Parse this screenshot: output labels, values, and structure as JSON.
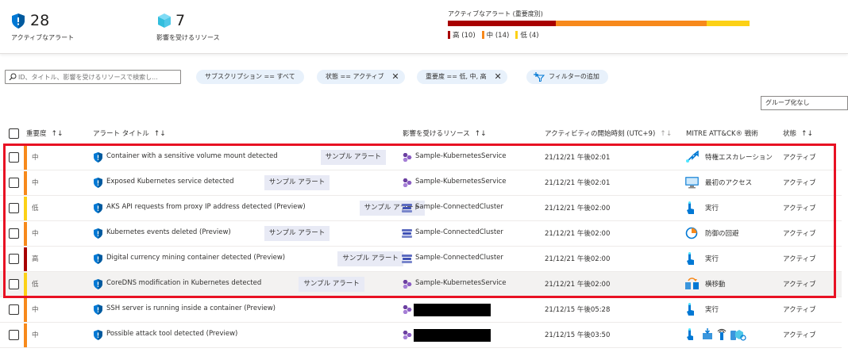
{
  "summary": {
    "active_alerts": {
      "count": "28",
      "label": "アクティブなアラート"
    },
    "affected_resources": {
      "count": "7",
      "label": "影響を受けるリソース"
    },
    "severity": {
      "title": "アクティブなアラート (重要度別)",
      "high": "高 (10)",
      "medium": "中 (14)",
      "low": "低 (4)",
      "colors": {
        "high": "#a80000",
        "medium": "#f7891b",
        "low": "#fcd116"
      },
      "shares": {
        "high": 0.357,
        "medium": 0.5,
        "low": 0.143
      }
    }
  },
  "filters": {
    "search_placeholder": "ID、タイトル、影響を受けるリソースで検索し...",
    "subscription": "サブスクリプション == すべて",
    "state": "状態 == アクティブ",
    "severity": "重要度 == 低, 中, 高",
    "add_filter": "フィルターの追加"
  },
  "group_by": "グループ化なし",
  "columns": {
    "severity": "重要度",
    "title": "アラート タイトル",
    "resource": "影響を受けるリソース",
    "start_time": "アクティビティの開始時刻 (UTC+9)",
    "tactics": "MITRE ATT&CK® 戦術",
    "status": "状態",
    "sort_glyph": "↑↓"
  },
  "sample_badge": "サンプル アラート",
  "rows": [
    {
      "severity": "中",
      "sev_color": "#f7891b",
      "title": "Container with a sensitive volume mount detected",
      "sample": true,
      "resource": "Sample-KubernetesService",
      "res_icon": "kubernetes-service-icon",
      "time": "21/12/21 午後02:01",
      "tactic": "特権エスカレーション",
      "tactic_icon": "privilege-escalation-icon",
      "status": "アクティブ"
    },
    {
      "severity": "中",
      "sev_color": "#f7891b",
      "title": "Exposed Kubernetes service detected",
      "sample": true,
      "resource": "Sample-KubernetesService",
      "res_icon": "kubernetes-service-icon",
      "time": "21/12/21 午後02:01",
      "tactic": "最初のアクセス",
      "tactic_icon": "initial-access-icon",
      "status": "アクティブ"
    },
    {
      "severity": "低",
      "sev_color": "#fcd116",
      "title": "AKS API requests from proxy IP address detected (Preview)",
      "sample": true,
      "resource": "Sample-ConnectedCluster",
      "res_icon": "connected-cluster-icon",
      "time": "21/12/21 午後02:00",
      "tactic": "実行",
      "tactic_icon": "execution-icon",
      "status": "アクティブ"
    },
    {
      "severity": "中",
      "sev_color": "#f7891b",
      "title": "Kubernetes events deleted (Preview)",
      "sample": true,
      "resource": "Sample-ConnectedCluster",
      "res_icon": "connected-cluster-icon",
      "time": "21/12/21 午後02:00",
      "tactic": "防御の回避",
      "tactic_icon": "defense-evasion-icon",
      "status": "アクティブ"
    },
    {
      "severity": "高",
      "sev_color": "#a80000",
      "title": "Digital currency mining container detected (Preview)",
      "sample": true,
      "resource": "Sample-ConnectedCluster",
      "res_icon": "connected-cluster-icon",
      "time": "21/12/21 午後02:00",
      "tactic": "実行",
      "tactic_icon": "execution-icon",
      "status": "アクティブ"
    },
    {
      "severity": "低",
      "sev_color": "#fcd116",
      "title": "CoreDNS modification in Kubernetes detected",
      "sample": true,
      "resource": "Sample-KubernetesService",
      "res_icon": "kubernetes-service-icon",
      "time": "21/12/21 午後02:00",
      "tactic": "横移動",
      "tactic_icon": "lateral-movement-icon",
      "status": "アクティブ"
    },
    {
      "severity": "中",
      "sev_color": "#f7891b",
      "title": "SSH server is running inside a container (Preview)",
      "sample": false,
      "resource": "",
      "res_icon": "kubernetes-service-icon",
      "time": "21/12/15 午後05:28",
      "tactic": "実行",
      "tactic_icon": "execution-icon",
      "status": "アクティブ"
    },
    {
      "severity": "中",
      "sev_color": "#f7891b",
      "title": "Possible attack tool detected (Preview)",
      "sample": false,
      "resource": "",
      "res_icon": "kubernetes-service-icon",
      "time": "21/12/15 午後03:50",
      "tactic": "",
      "tactic_icon": "multiple-tactics-icon",
      "status": "アクティブ"
    }
  ]
}
